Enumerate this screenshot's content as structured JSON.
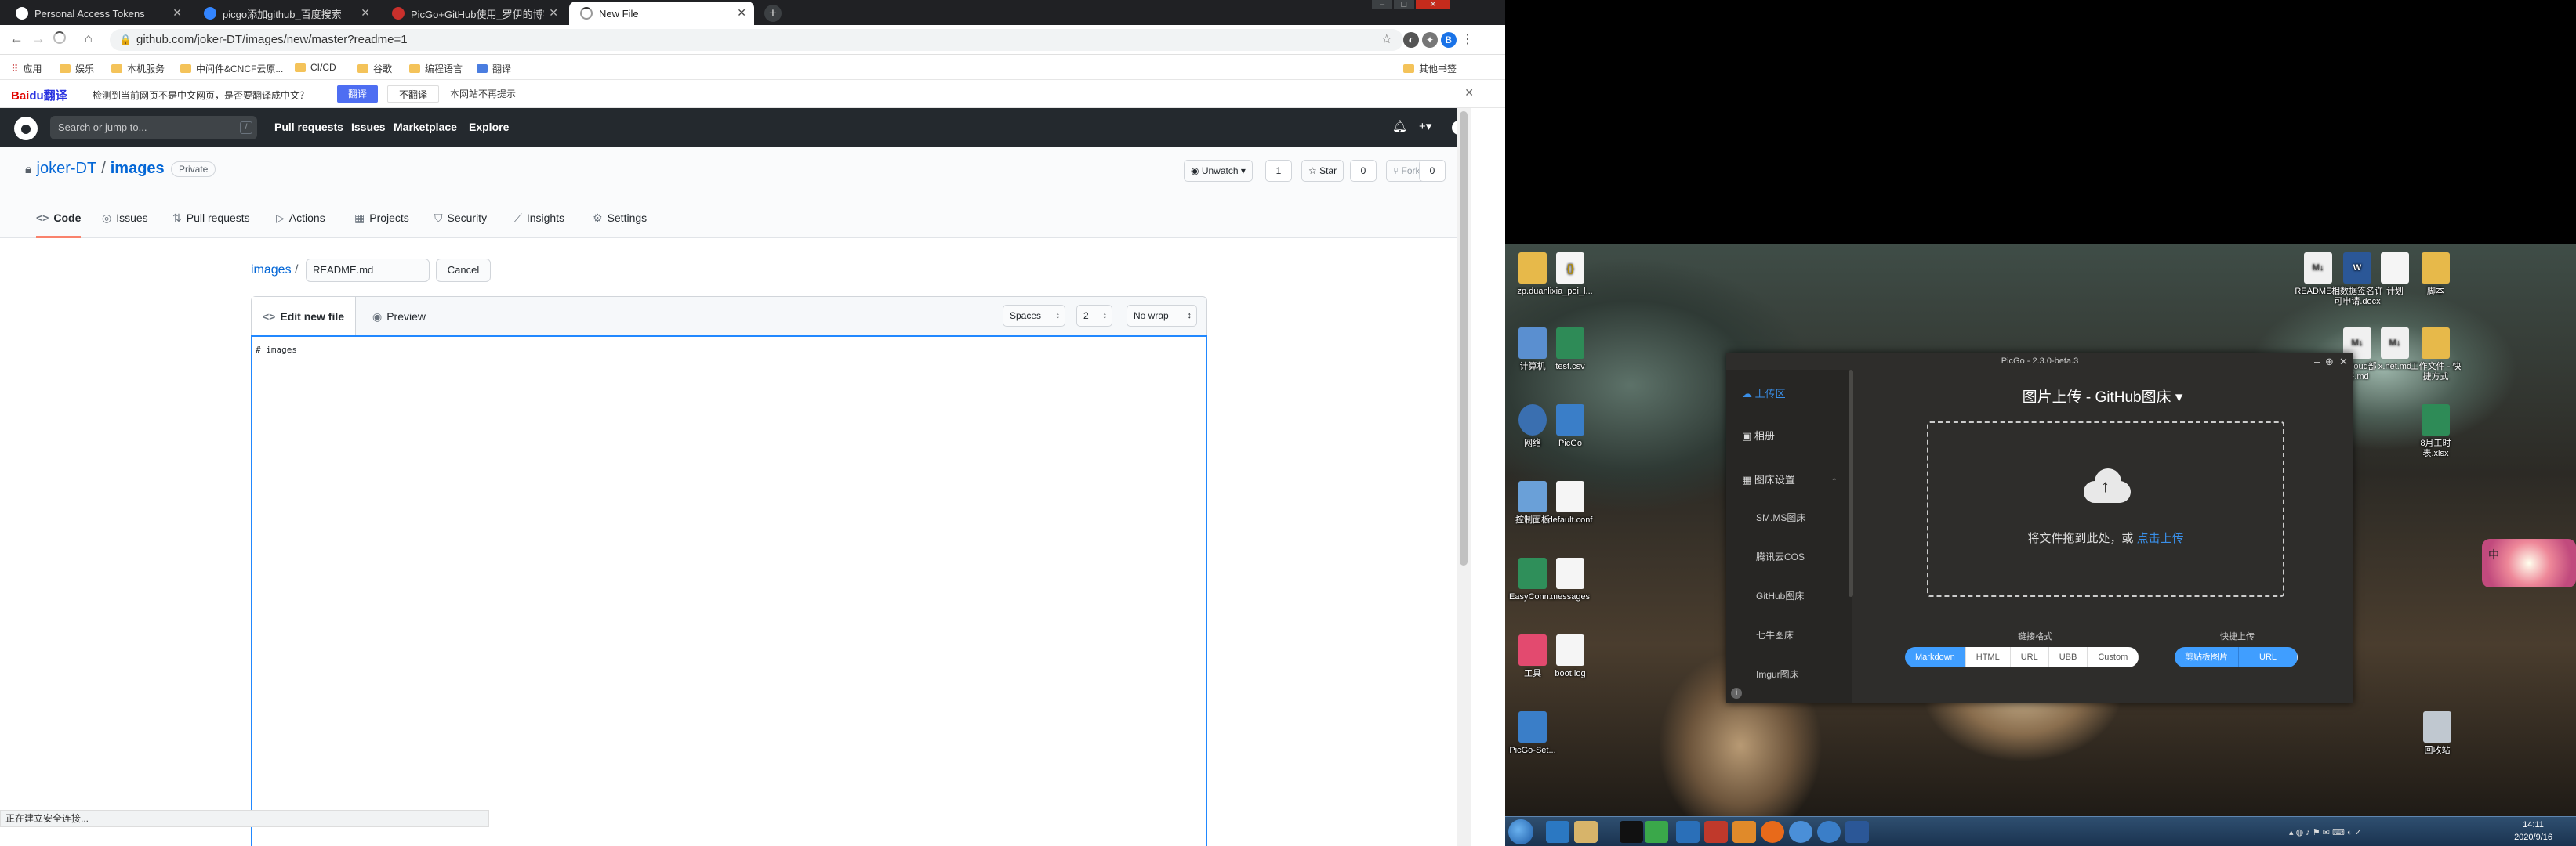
{
  "browser": {
    "tabs": [
      {
        "title": "Personal Access Tokens",
        "color": "#ffffff"
      },
      {
        "title": "picgo添加github_百度搜索",
        "color": "#3385ff"
      },
      {
        "title": "PicGo+GitHub使用_罗伊的博客",
        "color": "#c9302c"
      },
      {
        "title": "New File",
        "color": "#888888"
      }
    ],
    "url": "github.com/joker-DT/images/new/master?readme=1",
    "bookmarks": [
      "应用",
      "娱乐",
      "本机服务",
      "中间件&CNCF云原...",
      "CI/CD",
      "谷歌",
      "编程语言",
      "翻译",
      "其他书签"
    ],
    "status_text": "正在建立安全连接..."
  },
  "baidu_bar": {
    "logo_a": "Bai",
    "logo_b": "du翻译",
    "message": "检测到当前网页不是中文网页，是否要翻译成中文？",
    "translate": "翻译",
    "no_translate": "不翻译",
    "never": "本网站不再提示"
  },
  "github": {
    "search_placeholder": "Search or jump to...",
    "search_key": "/",
    "nav": [
      "Pull requests",
      "Issues",
      "Marketplace",
      "Explore"
    ],
    "owner": "joker-DT",
    "repo": "images",
    "visibility": "Private",
    "watch_label": "Unwatch",
    "watch_count": "1",
    "star_label": "Star",
    "star_count": "0",
    "fork_label": "Fork",
    "fork_count": "0",
    "repo_tabs": [
      "Code",
      "Issues",
      "Pull requests",
      "Actions",
      "Projects",
      "Security",
      "Insights",
      "Settings"
    ],
    "breadcrumb_repo": "images",
    "breadcrumb_sep": "/",
    "filename": "README.md",
    "cancel": "Cancel",
    "edit_tab": "Edit new file",
    "preview_tab": "Preview",
    "indent_mode": "Spaces",
    "indent_size": "2",
    "wrap_mode": "No wrap",
    "editor_content": "# images"
  },
  "desktop": {
    "icons_left": [
      {
        "label": "zp.duan",
        "color": "#e7b94a"
      },
      {
        "label": "lixia_poi_l...",
        "color": "#f5f5f5"
      },
      {
        "label": "计算机",
        "color": "#5a8fd0"
      },
      {
        "label": "test.csv",
        "color": "#2e8b57"
      },
      {
        "label": "网络",
        "color": "#3a6fb0"
      },
      {
        "label": "PicGo",
        "color": "#3a7ec8"
      },
      {
        "label": "控制面板",
        "color": "#6aa0d8"
      },
      {
        "label": "default.conf",
        "color": "#f5f5f5"
      },
      {
        "label": "EasyConn...",
        "color": "#2f8f5a"
      },
      {
        "label": "messages",
        "color": "#f5f5f5"
      },
      {
        "label": "工具",
        "color": "#e34a6f"
      },
      {
        "label": "boot.log",
        "color": "#f5f5f5"
      },
      {
        "label": "PicGo-Set...",
        "color": "#3a7ec8"
      }
    ],
    "icons_right": [
      {
        "label": "README....",
        "color": "#f0f0f0"
      },
      {
        "label": "相数据签名许可申请.docx",
        "color": "#2b5797"
      },
      {
        "label": "计划",
        "color": "#f5f5f5"
      },
      {
        "label": "脚本",
        "color": "#e7b94a"
      },
      {
        "label": "docloud部署.md",
        "color": "#f0f0f0"
      },
      {
        "label": "x.net.md",
        "color": "#f0f0f0"
      },
      {
        "label": "工作文件 - 快捷方式",
        "color": "#e7b94a"
      },
      {
        "label": "8月工时表.xlsx",
        "color": "#2e8b57"
      },
      {
        "label": "回收站",
        "color": "#c0c8d0"
      }
    ],
    "clock_time": "14:11",
    "clock_date": "2020/9/16",
    "float_widget": "中"
  },
  "picgo": {
    "title": "PicGo - 2.3.0-beta.3",
    "side_upload": "上传区",
    "side_album": "相册",
    "side_settings": "图床设置",
    "side_sub": [
      "SM.MS图床",
      "腾讯云COS",
      "GitHub图床",
      "七牛图床",
      "Imgur图床"
    ],
    "header": "图片上传 - GitHub图床",
    "drop_text": "将文件拖到此处，或",
    "drop_link": "点击上传",
    "link_format_label": "链接格式",
    "formats": [
      "Markdown",
      "HTML",
      "URL",
      "UBB",
      "Custom"
    ],
    "quick_label": "快捷上传",
    "quick": [
      "剪贴板图片",
      "URL"
    ]
  }
}
